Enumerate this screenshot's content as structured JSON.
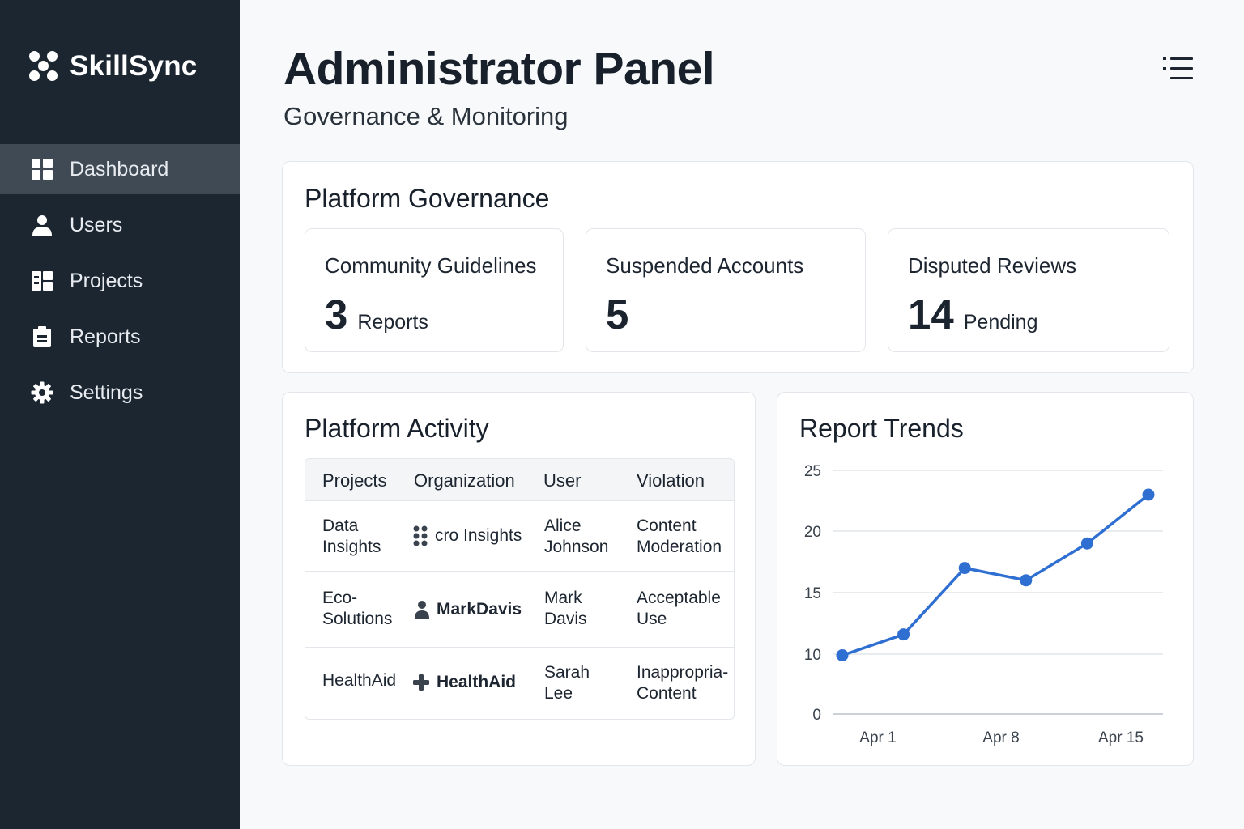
{
  "app": {
    "name": "SkillSync"
  },
  "sidebar": {
    "items": [
      {
        "label": "Dashboard",
        "icon": "dashboard-icon",
        "active": true
      },
      {
        "label": "Users",
        "icon": "user-icon",
        "active": false
      },
      {
        "label": "Projects",
        "icon": "projects-icon",
        "active": false
      },
      {
        "label": "Reports",
        "icon": "clipboard-icon",
        "active": false
      },
      {
        "label": "Settings",
        "icon": "gear-icon",
        "active": false
      }
    ]
  },
  "header": {
    "title": "Administrator Panel",
    "subtitle": "Governance & Monitoring",
    "menu_icon": "list-menu-icon"
  },
  "governance": {
    "title": "Platform Governance",
    "metrics": [
      {
        "label": "Community Guidelines",
        "value": "3",
        "unit": "Reports"
      },
      {
        "label": "Suspended Accounts",
        "value": "5",
        "unit": ""
      },
      {
        "label": "Disputed Reviews",
        "value": "14",
        "unit": "Pending"
      }
    ]
  },
  "activity": {
    "title": "Platform Activity",
    "columns": [
      "Projects",
      "Organization",
      "User",
      "Violation"
    ],
    "rows": [
      {
        "project": "Data\nInsights",
        "org": "cro Insights",
        "org_icon": "dots-icon",
        "user": "Alice\nJohnson",
        "violation": "Content\nModeration"
      },
      {
        "project": "Eco-\nSolutions",
        "org": "MarkDavis",
        "org_icon": "person-icon",
        "user": "Mark\nDavis",
        "violation": "Acceptable\nUse"
      },
      {
        "project": "HealthAid",
        "org": "HealthAid",
        "org_icon": "plus-icon",
        "user": "Sarah\nLee",
        "violation": "Inappropria-\nContent"
      }
    ]
  },
  "trends": {
    "title": "Report Trends"
  },
  "chart_data": {
    "type": "line",
    "title": "Report Trends",
    "x_ticks": [
      "Apr 1",
      "Apr 8",
      "Apr 15"
    ],
    "y_ticks": [
      0,
      10,
      15,
      20,
      25
    ],
    "series": [
      {
        "values": [
          9.8,
          11.6,
          17.0,
          16.0,
          19.0,
          23.0
        ]
      }
    ],
    "line_color": "#2f6fd1",
    "grid": true
  },
  "colors": {
    "sidebar": "#1b2631",
    "active_nav": "#3f4a55",
    "accent": "#2f6fd1"
  }
}
